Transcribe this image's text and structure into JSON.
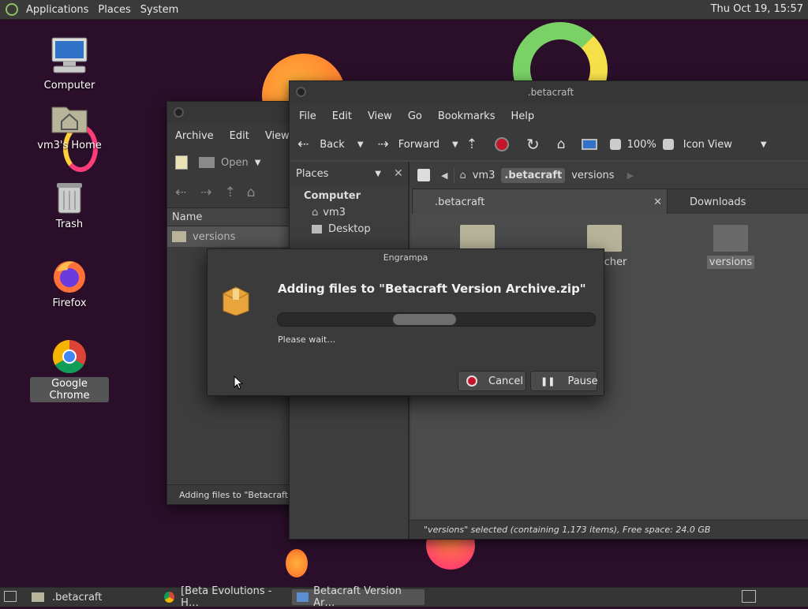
{
  "top_panel": {
    "menus": [
      "Applications",
      "Places",
      "System"
    ],
    "clock": "Thu Oct 19, 15:57"
  },
  "desktop": {
    "icons": [
      {
        "label": "Computer"
      },
      {
        "label": "vm3's Home"
      },
      {
        "label": "Trash"
      },
      {
        "label": "Firefox"
      },
      {
        "label": "Google Chrome"
      }
    ]
  },
  "archive_window": {
    "menus": [
      "Archive",
      "Edit",
      "View"
    ],
    "open_label": "Open",
    "column_name": "Name",
    "row_label": "versions",
    "status": "Adding files to \"Betacraft Versi"
  },
  "file_manager": {
    "title": ".betacraft",
    "menus": [
      "File",
      "Edit",
      "View",
      "Go",
      "Bookmarks",
      "Help"
    ],
    "toolbar": {
      "back": "Back",
      "forward": "Forward",
      "zoom": "100%",
      "view_mode": "Icon View"
    },
    "sidebar_selector": "Places",
    "sidebar_items": {
      "header": "Computer",
      "items": [
        "vm3",
        "Desktop"
      ]
    },
    "path": [
      "vm3",
      ".betacraft",
      "versions"
    ],
    "tabs": [
      ".betacraft",
      "Downloads"
    ],
    "files": [
      {
        "label": ""
      },
      {
        "label": "launcher"
      },
      {
        "label": "versions"
      }
    ],
    "status": "\"versions\" selected (containing 1,173 items), Free space: 24.0 GB"
  },
  "dialog": {
    "title": "Engrampa",
    "heading": "Adding files to \"Betacraft Version Archive.zip\"",
    "message": "Please wait…",
    "cancel": "Cancel",
    "pause": "Pause"
  },
  "taskbar": {
    "tasks": [
      {
        "label": ".betacraft"
      },
      {
        "label": "[Beta Evolutions - H…"
      },
      {
        "label": "Betacraft Version Ar…"
      }
    ]
  },
  "colors": {
    "accent_red": "#c4152a",
    "folder": "#b8b49a",
    "archive_box": "#e9a53c"
  }
}
